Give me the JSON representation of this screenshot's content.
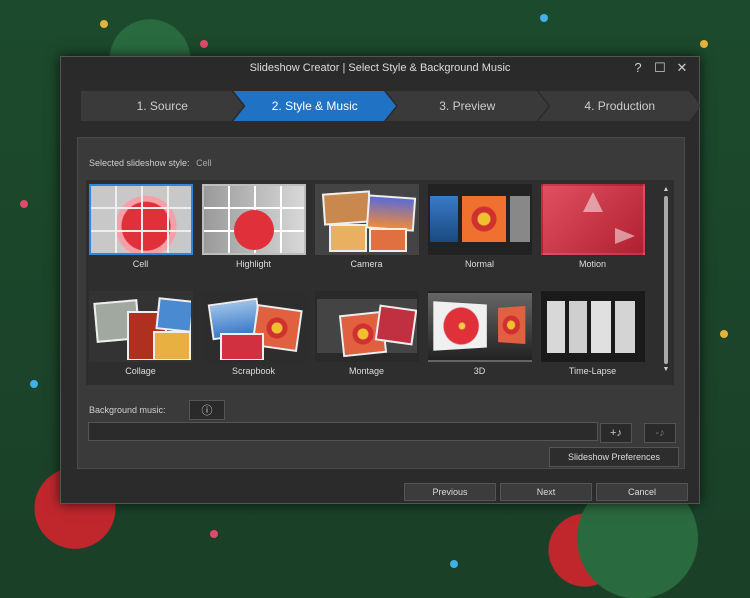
{
  "window": {
    "title": "Slideshow Creator | Select Style & Background Music",
    "controls": [
      "?",
      "☐",
      "✕"
    ]
  },
  "steps": [
    {
      "label": "1. Source",
      "active": false
    },
    {
      "label": "2. Style & Music",
      "active": true
    },
    {
      "label": "3. Preview",
      "active": false
    },
    {
      "label": "4. Production",
      "active": false
    }
  ],
  "style_panel": {
    "selected_label": "Selected slideshow style:",
    "selected_value": "Cell"
  },
  "styles": [
    {
      "name": "Cell",
      "selected": true
    },
    {
      "name": "Highlight",
      "selected": false
    },
    {
      "name": "Camera",
      "selected": false
    },
    {
      "name": "Normal",
      "selected": false
    },
    {
      "name": "Motion",
      "selected": false
    },
    {
      "name": "Collage",
      "selected": false
    },
    {
      "name": "Scrapbook",
      "selected": false
    },
    {
      "name": "Montage",
      "selected": false
    },
    {
      "name": "3D",
      "selected": false
    },
    {
      "name": "Time-Lapse",
      "selected": false
    }
  ],
  "music": {
    "label": "Background music:",
    "info_icon": "info-icon",
    "value": "",
    "add_icon": "add-music-icon",
    "remove_icon": "remove-music-icon",
    "add_symbol": "+♪",
    "remove_symbol": "-♪"
  },
  "buttons": {
    "preferences": "Slideshow Preferences",
    "previous": "Previous",
    "next": "Next",
    "cancel": "Cancel"
  },
  "colors": {
    "accent": "#1f72c4",
    "selected_border": "#2f86e0"
  }
}
